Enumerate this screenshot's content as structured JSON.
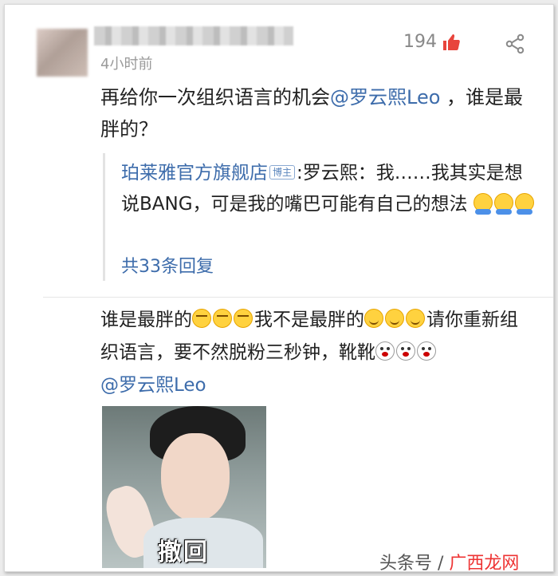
{
  "comment": {
    "time": "4小时前",
    "likes": "194",
    "text_prefix": "再给你一次组织语言的机会",
    "mention": "@罗云熙Leo",
    "text_suffix": " ，谁是最胖的？"
  },
  "quote": {
    "shop_name": "珀莱雅官方旗舰店",
    "badge": "博主",
    "text": ":罗云熙：我……我其实是想说BANG，可是我的嘴巴可能有自己的想法",
    "emojis": [
      "hands",
      "hands",
      "hands"
    ],
    "replies": "共33条回复"
  },
  "comment2": {
    "part1": "谁是最胖的",
    "emojis1": [
      "tired",
      "tired",
      "tired"
    ],
    "part2": "我不是最胖的",
    "emojis2": [
      "smile",
      "smile",
      "smile"
    ],
    "part3": "请你重新组织语言，要不然脱粉三秒钟，靴靴",
    "emojis3": [
      "shock",
      "shock",
      "shock"
    ],
    "mention": "@罗云熙Leo"
  },
  "meme": {
    "caption": "撤回"
  },
  "watermark": {
    "text_prefix": "头条号 / ",
    "text_brand": "广西龙网"
  },
  "colors": {
    "link": "#3d6cab",
    "like": "#e8453c"
  }
}
